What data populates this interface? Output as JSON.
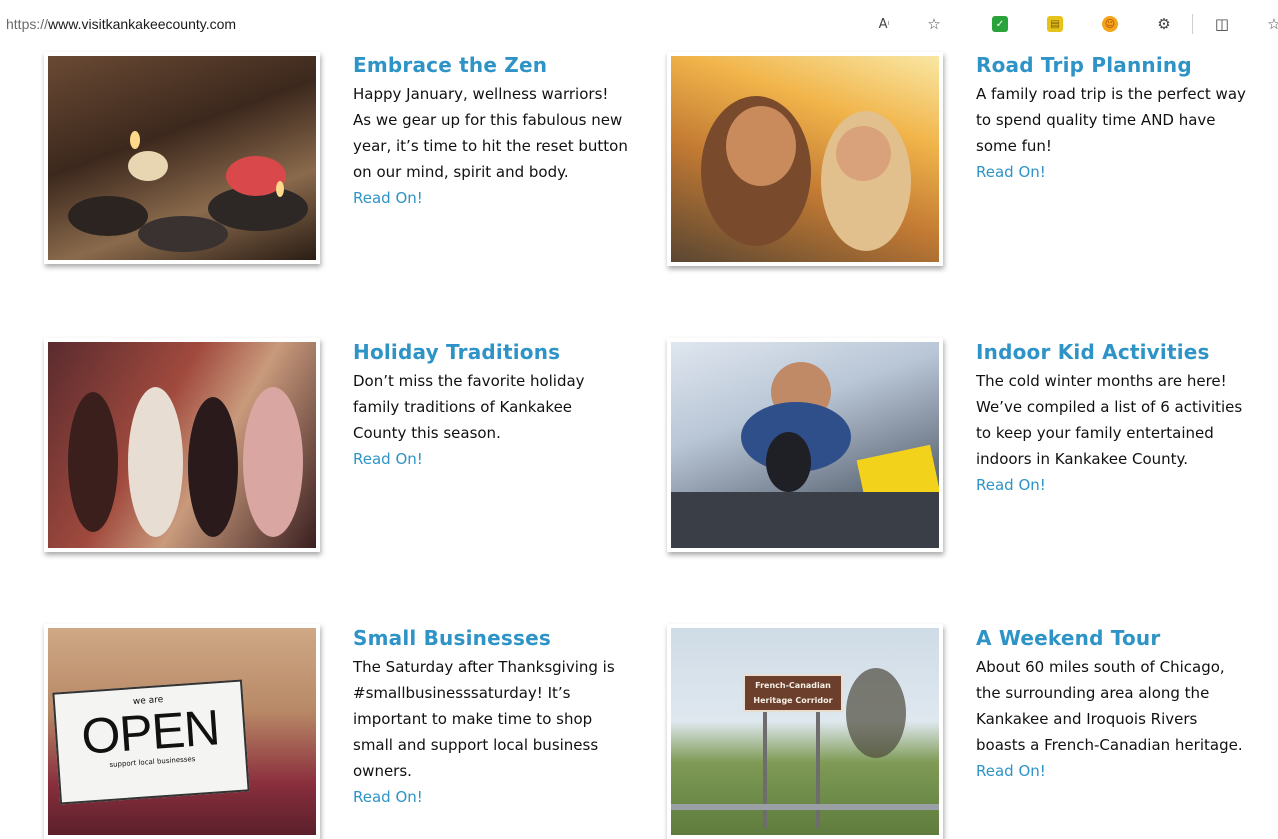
{
  "browser": {
    "url_proto": "https://",
    "url_host": "www.visitkankakeecounty.com",
    "icons": [
      "read-aloud-icon",
      "favorite-star-icon",
      "extension-check-icon",
      "extension-coupon-icon",
      "extension-honey-icon",
      "extensions-puzzle-icon",
      "split-screen-icon",
      "favorites-icon"
    ]
  },
  "colors": {
    "accent": "#2e93c6",
    "text": "#111111"
  },
  "articles": [
    {
      "title": "Embrace the Zen",
      "body": "Happy January, wellness warriors! As we gear up for this fabulous new year, it’s time to hit the reset button on our mind, spirit and body.",
      "link": "Read On!"
    },
    {
      "title": "Road Trip Planning",
      "body": "A family road trip is the perfect way to spend quality time AND have some fun!",
      "link": "Read On!"
    },
    {
      "title": "Holiday Traditions",
      "body": "Don’t miss the favorite holiday family traditions of Kankakee County this season.",
      "link": "Read On!"
    },
    {
      "title": "Indoor Kid Activities",
      "body": "The cold winter months are here! We’ve compiled a list of 6 activities to keep your family entertained indoors in Kankakee County.",
      "link": "Read On!"
    },
    {
      "title": "Small Businesses",
      "body": "The Saturday after Thanksgiving is #smallbusinesssaturday! It’s important to make time to shop small and support local business owners.",
      "link": "Read On!"
    },
    {
      "title": "A Weekend Tour",
      "body": "About 60 miles south of Chicago, the surrounding area along the Kankakee and Iroquois Rivers boasts a French-Canadian heritage.",
      "link": "Read On!"
    }
  ],
  "photo_text": {
    "open_sign_top": "we are",
    "open_sign_main": "OPEN",
    "open_sign_bottom": "support local businesses",
    "heritage_sign": "French-Canadian Heritage Corridor"
  }
}
